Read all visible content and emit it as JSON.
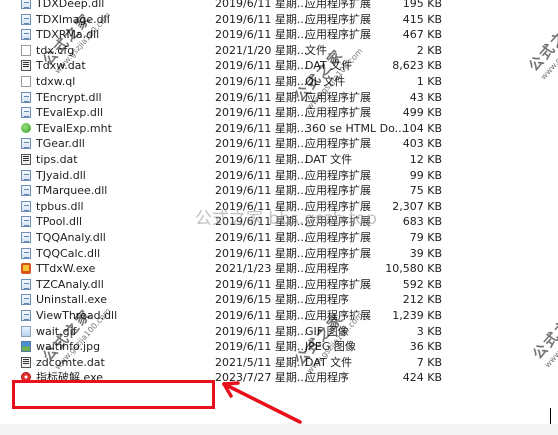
{
  "files": [
    {
      "name": "TDXDeep.dll",
      "date": "2019/6/11 星期...",
      "type": "应用程序扩展",
      "size": "195 KB",
      "icon": "dll-icon"
    },
    {
      "name": "TDXImage.dll",
      "date": "2019/6/11 星期...",
      "type": "应用程序扩展",
      "size": "415 KB",
      "icon": "dll-icon"
    },
    {
      "name": "TDXRMa.dll",
      "date": "2019/6/11 星期...",
      "type": "应用程序扩展",
      "size": "467 KB",
      "icon": "dll-icon"
    },
    {
      "name": "tdx.cfg",
      "date": "2021/1/20 星期...",
      "type": "文件",
      "size": "2 KB",
      "icon": "document-icon"
    },
    {
      "name": "Tdxw.dat",
      "date": "2019/6/11 星期...",
      "type": "DAT 文件",
      "size": "8,623 KB",
      "icon": "dat-icon"
    },
    {
      "name": "tdxw.ql",
      "date": "2019/6/11 星期...",
      "type": "QL 文件",
      "size": "1 KB",
      "icon": "document-icon"
    },
    {
      "name": "TEncrypt.dll",
      "date": "2019/6/11 星期...",
      "type": "应用程序扩展",
      "size": "43 KB",
      "icon": "dll-icon"
    },
    {
      "name": "TEvalExp.dll",
      "date": "2019/6/11 星期...",
      "type": "应用程序扩展",
      "size": "499 KB",
      "icon": "dll-icon"
    },
    {
      "name": "TEvalExp.mht",
      "date": "2019/6/11 星期...",
      "type": "360 se HTML Do...",
      "size": "104 KB",
      "icon": "browser-icon"
    },
    {
      "name": "TGear.dll",
      "date": "2019/6/11 星期...",
      "type": "应用程序扩展",
      "size": "403 KB",
      "icon": "dll-icon"
    },
    {
      "name": "tips.dat",
      "date": "2019/6/11 星期...",
      "type": "DAT 文件",
      "size": "12 KB",
      "icon": "dat-icon"
    },
    {
      "name": "TJyaid.dll",
      "date": "2019/6/11 星期...",
      "type": "应用程序扩展",
      "size": "99 KB",
      "icon": "dll-icon"
    },
    {
      "name": "TMarquee.dll",
      "date": "2019/6/11 星期...",
      "type": "应用程序扩展",
      "size": "75 KB",
      "icon": "dll-icon"
    },
    {
      "name": "tpbus.dll",
      "date": "2019/6/11 星期...",
      "type": "应用程序扩展",
      "size": "2,307 KB",
      "icon": "dll-icon"
    },
    {
      "name": "TPool.dll",
      "date": "2019/6/11 星期...",
      "type": "应用程序扩展",
      "size": "683 KB",
      "icon": "dll-icon"
    },
    {
      "name": "TQQAnaly.dll",
      "date": "2019/6/11 星期...",
      "type": "应用程序扩展",
      "size": "79 KB",
      "icon": "dll-icon"
    },
    {
      "name": "TQQCalc.dll",
      "date": "2019/6/11 星期...",
      "type": "应用程序扩展",
      "size": "39 KB",
      "icon": "dll-icon"
    },
    {
      "name": "TTdxW.exe",
      "date": "2021/1/23 星期...",
      "type": "应用程序",
      "size": "10,580 KB",
      "icon": "exe-icon"
    },
    {
      "name": "TZCAnaly.dll",
      "date": "2019/6/11 星期...",
      "type": "应用程序扩展",
      "size": "592 KB",
      "icon": "dll-icon"
    },
    {
      "name": "Uninstall.exe",
      "date": "2019/6/15 星期...",
      "type": "应用程序",
      "size": "212 KB",
      "icon": "dll-icon"
    },
    {
      "name": "ViewThread.dll",
      "date": "2019/6/11 星期...",
      "type": "应用程序扩展",
      "size": "1,239 KB",
      "icon": "dll-icon"
    },
    {
      "name": "wait.gif",
      "date": "2019/6/11 星期...",
      "type": "GIF 图像",
      "size": "3 KB",
      "icon": "gif-icon"
    },
    {
      "name": "waitinfo.jpg",
      "date": "2019/6/11 星期...",
      "type": "JPEG 图像",
      "size": "36 KB",
      "icon": "jpg-icon"
    },
    {
      "name": "zdcomte.dat",
      "date": "2021/5/11 星期...",
      "type": "DAT 文件",
      "size": "7 KB",
      "icon": "dat-icon"
    },
    {
      "name": "指标破解.exe",
      "date": "2023/7/27 星期...",
      "type": "应用程序",
      "size": "424 KB",
      "icon": "target-exe-icon"
    }
  ],
  "watermarks": {
    "brand": "公式之家",
    "url": "www.gszjia100.com",
    "center": "公式之家 bbs.gszb.top"
  },
  "colors": {
    "annotation": "#e8101d"
  }
}
